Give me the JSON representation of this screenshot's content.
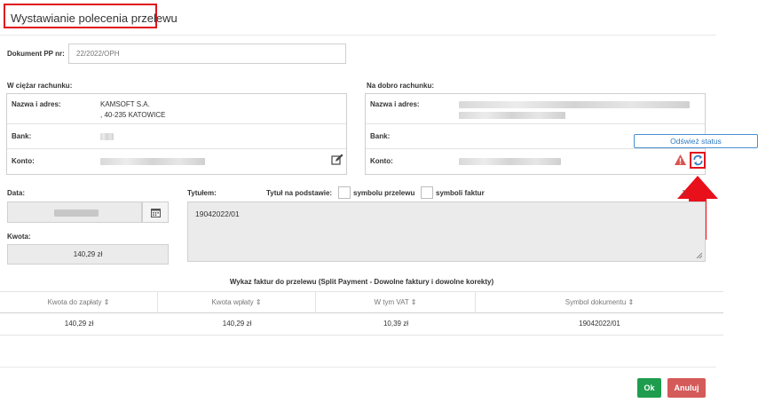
{
  "dialog": {
    "title": "Wystawianie polecenia przelewu"
  },
  "document": {
    "label": "Dokument PP nr:",
    "value": "22/2022/OPH"
  },
  "debit_account": {
    "header": "W ciężar rachunku:",
    "name_label": "Nazwa i adres:",
    "name_line1": "KAMSOFT S.A.",
    "name_line2": ", 40-235 KATOWICE",
    "bank_label": "Bank:",
    "account_label": "Konto:"
  },
  "credit_account": {
    "header": "Na dobro rachunku:",
    "name_label": "Nazwa i adres:",
    "bank_label": "Bank:",
    "account_label": "Konto:",
    "refresh_status_label": "Odśwież status"
  },
  "date": {
    "label": "Data:"
  },
  "amount": {
    "label": "Kwota:",
    "value": "140,29 zł"
  },
  "title_field": {
    "label": "Tytułem:",
    "basis_label": "Tytuł na podstawie:",
    "option_transfer": "symbolu przelewu",
    "option_invoices": "symboli faktur",
    "counter": "1",
    "value": "19042022/01"
  },
  "invoices_table": {
    "title": "Wykaz faktur do przelewu (Split Payment - Dowolne faktury i dowolne korekty)",
    "columns": [
      "Kwota do zapłaty ⇕",
      "Kwota wpłaty ⇕",
      "W tym VAT ⇕",
      "Symbol dokumentu ⇕"
    ],
    "rows": [
      [
        "140,29 zł",
        "140,29 zł",
        "10,39 zł",
        "19042022/01"
      ]
    ]
  },
  "footer": {
    "ok_label": "Ok",
    "cancel_label": "Anuluj"
  },
  "colors": {
    "highlight_red": "#e0141e",
    "ok_green": "#1e9d4e",
    "cancel_red": "#d55a5a",
    "link_blue": "#2f7bc4"
  }
}
